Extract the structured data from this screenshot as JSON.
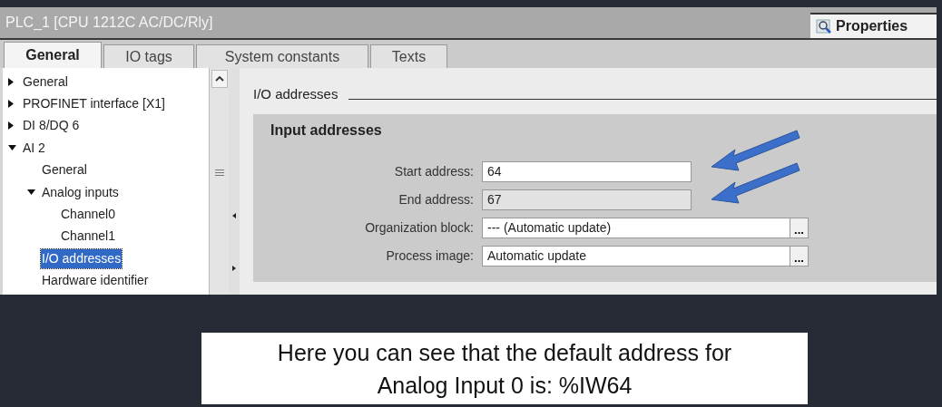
{
  "window": {
    "title": "PLC_1 [CPU 1212C AC/DC/Rly]"
  },
  "inspector_tabs": [
    {
      "label": "Properties",
      "selected": true
    }
  ],
  "tabs": [
    {
      "label": "General",
      "selected": true
    },
    {
      "label": "IO tags",
      "selected": false
    },
    {
      "label": "System constants",
      "selected": false
    },
    {
      "label": "Texts",
      "selected": false
    }
  ],
  "tree": [
    {
      "label": "General",
      "expanded": false,
      "selected": false
    },
    {
      "label": "PROFINET interface [X1]",
      "expanded": false,
      "selected": false
    },
    {
      "label": "DI 8/DQ 6",
      "expanded": false,
      "selected": false
    },
    {
      "label": "AI 2",
      "expanded": true,
      "selected": false,
      "children": [
        {
          "label": "General",
          "selected": false
        },
        {
          "label": "Analog inputs",
          "expanded": true,
          "selected": false,
          "children": [
            {
              "label": "Channel0",
              "selected": false
            },
            {
              "label": "Channel1",
              "selected": false
            }
          ]
        },
        {
          "label": "I/O addresses",
          "selected": true
        },
        {
          "label": "Hardware identifier",
          "selected": false
        }
      ]
    }
  ],
  "section": {
    "title": "I/O addresses",
    "group_title": "Input addresses",
    "fields": [
      {
        "label": "Start address:",
        "value": "64",
        "disabled": false
      },
      {
        "label": "End address:",
        "value": "67",
        "disabled": true
      },
      {
        "label": "Organization block:",
        "value": "--- (Automatic update)",
        "disabled": false,
        "browse": "..."
      },
      {
        "label": "Process image:",
        "value": "Automatic update",
        "disabled": false,
        "browse": "..."
      }
    ]
  },
  "caption": "Here you can see that the default address for Analog Input 0 is: %IW64"
}
